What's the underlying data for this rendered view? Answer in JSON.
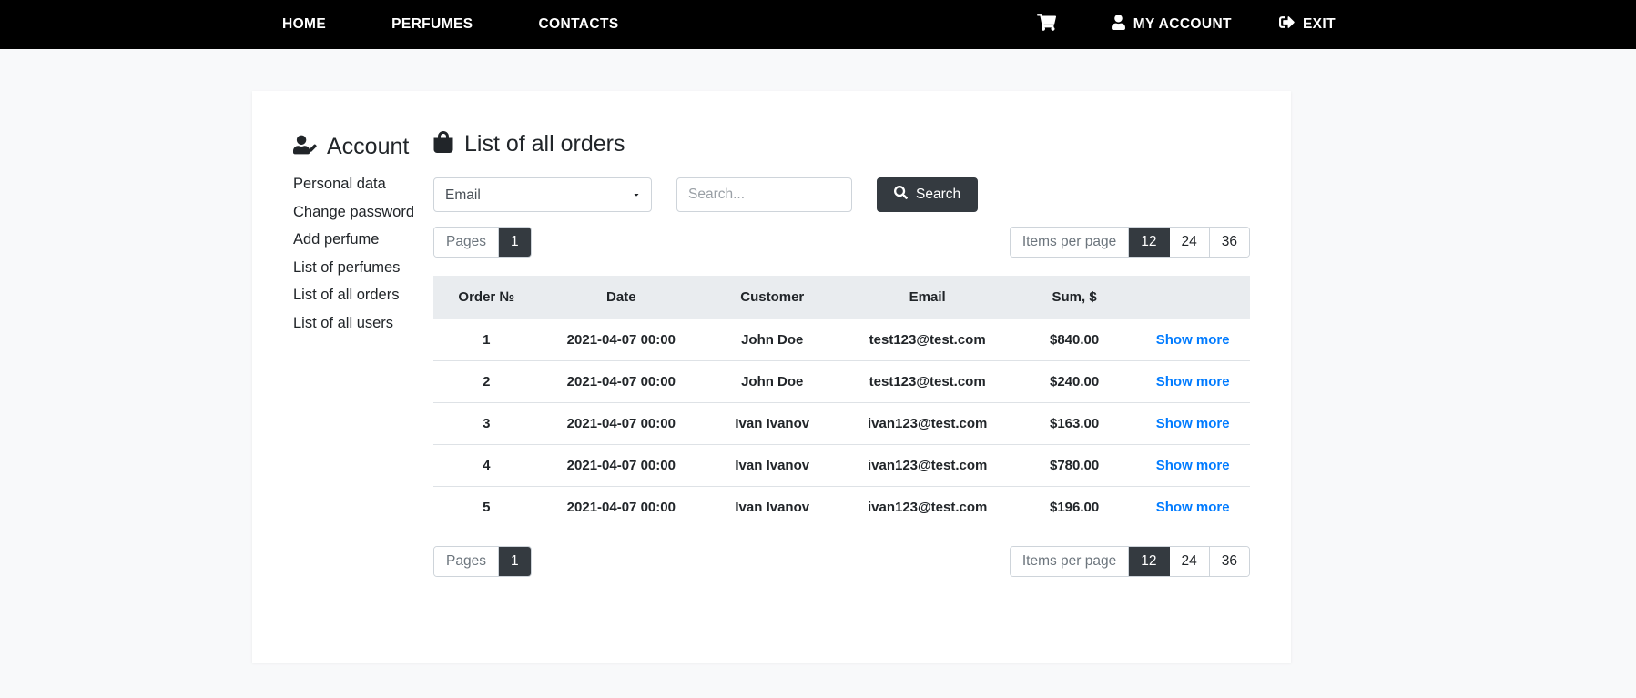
{
  "navbar": {
    "links": [
      {
        "label": "HOME",
        "name": "nav-home"
      },
      {
        "label": "PERFUMES",
        "name": "nav-perfumes"
      },
      {
        "label": "CONTACTS",
        "name": "nav-contacts"
      }
    ],
    "cart_icon": "shopping-cart-icon",
    "account_label": "MY ACCOUNT",
    "account_icon": "user-icon",
    "exit_label": "EXIT",
    "exit_icon": "sign-out-icon",
    "background": "#000000"
  },
  "sidebar": {
    "title": "Account",
    "title_icon": "user-edit-icon",
    "items": [
      {
        "label": "Personal data"
      },
      {
        "label": "Change password"
      },
      {
        "label": "Add perfume"
      },
      {
        "label": "List of perfumes"
      },
      {
        "label": "List of all orders"
      },
      {
        "label": "List of all users"
      }
    ]
  },
  "main": {
    "title": "List of all orders",
    "title_icon": "shopping-bag-icon"
  },
  "search": {
    "select_value": "Email",
    "select_options": [
      "Email"
    ],
    "input_value": "",
    "placeholder": "Search...",
    "button_label": "Search",
    "button_icon": "search-icon",
    "button_color": "#343a40"
  },
  "pagination": {
    "pages_label": "Pages",
    "pages": [
      "1"
    ],
    "active_page": "1",
    "items_label": "Items per page",
    "items_options": [
      "12",
      "24",
      "36"
    ],
    "active_items": "12"
  },
  "table": {
    "columns": [
      "Order №",
      "Date",
      "Customer",
      "Email",
      "Sum, $",
      ""
    ],
    "action_label": "Show more",
    "action_color": "#007bff",
    "rows": [
      {
        "no": "1",
        "date": "2021-04-07 00:00",
        "customer": "John Doe",
        "email": "test123@test.com",
        "sum": "$840.00",
        "action": "Show more"
      },
      {
        "no": "2",
        "date": "2021-04-07 00:00",
        "customer": "John Doe",
        "email": "test123@test.com",
        "sum": "$240.00",
        "action": "Show more"
      },
      {
        "no": "3",
        "date": "2021-04-07 00:00",
        "customer": "Ivan Ivanov",
        "email": "ivan123@test.com",
        "sum": "$163.00",
        "action": "Show more"
      },
      {
        "no": "4",
        "date": "2021-04-07 00:00",
        "customer": "Ivan Ivanov",
        "email": "ivan123@test.com",
        "sum": "$780.00",
        "action": "Show more"
      },
      {
        "no": "5",
        "date": "2021-04-07 00:00",
        "customer": "Ivan Ivanov",
        "email": "ivan123@test.com",
        "sum": "$196.00",
        "action": "Show more"
      }
    ]
  }
}
